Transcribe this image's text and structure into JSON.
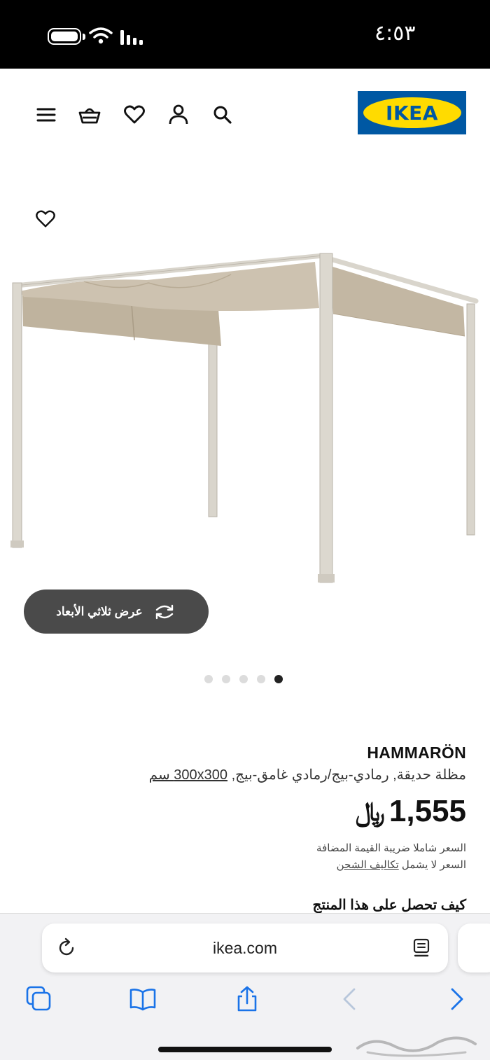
{
  "status_bar": {
    "time": "٤:٥٣"
  },
  "header": {
    "logo_text": "IKEA",
    "icons": [
      "menu-icon",
      "basket-icon",
      "heart-icon",
      "user-icon",
      "search-icon"
    ]
  },
  "product": {
    "name": "HAMMARÖN",
    "description": "مظلة حديقة, رمادي-بيج/رمادي غامق-بيج, ",
    "size": "300x300 سم",
    "price": "1,555",
    "currency_symbol": "﷼",
    "vat_note": "السعر شاملا ضريبة القيمة المضافة",
    "shipping_note_prefix": "السعر لا يشمل ",
    "shipping_link": "تكاليف الشحن",
    "section_heading": "كيف تحصل على هذا المنتج"
  },
  "gallery": {
    "view_3d_label": "عرض ثلاثي الأبعاد",
    "dot_count": 5,
    "active_index": 4
  },
  "browser": {
    "url": "ikea.com",
    "toolbar": [
      "tabs-icon",
      "bookmarks-icon",
      "share-icon",
      "back-icon",
      "forward-icon"
    ]
  },
  "colors": {
    "ikea_blue": "#0058a3",
    "ikea_yellow": "#ffdb00",
    "canopy": "#c7bba8",
    "frame": "#d9d5cc",
    "link_blue": "#1a73e8"
  }
}
